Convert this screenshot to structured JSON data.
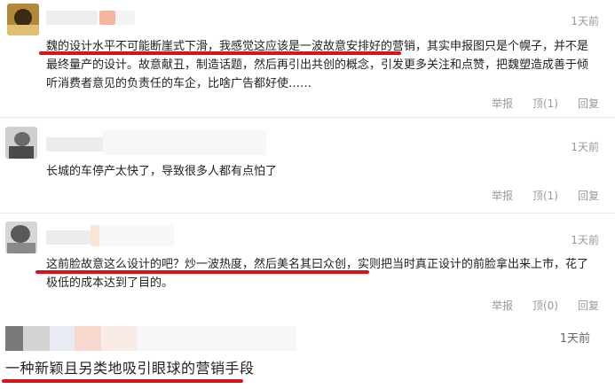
{
  "comments": [
    {
      "time": "1天前",
      "text": "魏的设计水平不可能断崖式下滑，我感觉这应该是一波故意安排好的营销，其实申报图只是个幌子，并不是最终量产的设计。故意献丑，制造话题，然后再引出共创的概念，引发更多关注和点赞，把魏塑造成善于倾听消费者意见的负责任的车企，比啥广告都好使……",
      "report": "举报",
      "like": "顶(1)",
      "reply": "回复"
    },
    {
      "time": "1天前",
      "text": "长城的车停产太快了，导致很多人都有点怕了",
      "report": "举报",
      "like": "顶(1)",
      "reply": "回复"
    },
    {
      "time": "1天前",
      "text": "这前脸故意这么设计的吧？炒一波热度，然后美名其曰众创，实则把当时真正设计的前脸拿出来上市，花了极低的成本达到了目的。",
      "report": "举报",
      "like": "顶(0)",
      "reply": "回复"
    }
  ],
  "snippet": {
    "time": "1天前",
    "text": "一种新颖且另类地吸引眼球的营销手段"
  },
  "colors": {
    "underline": "#d8141b",
    "muted": "#999999"
  }
}
